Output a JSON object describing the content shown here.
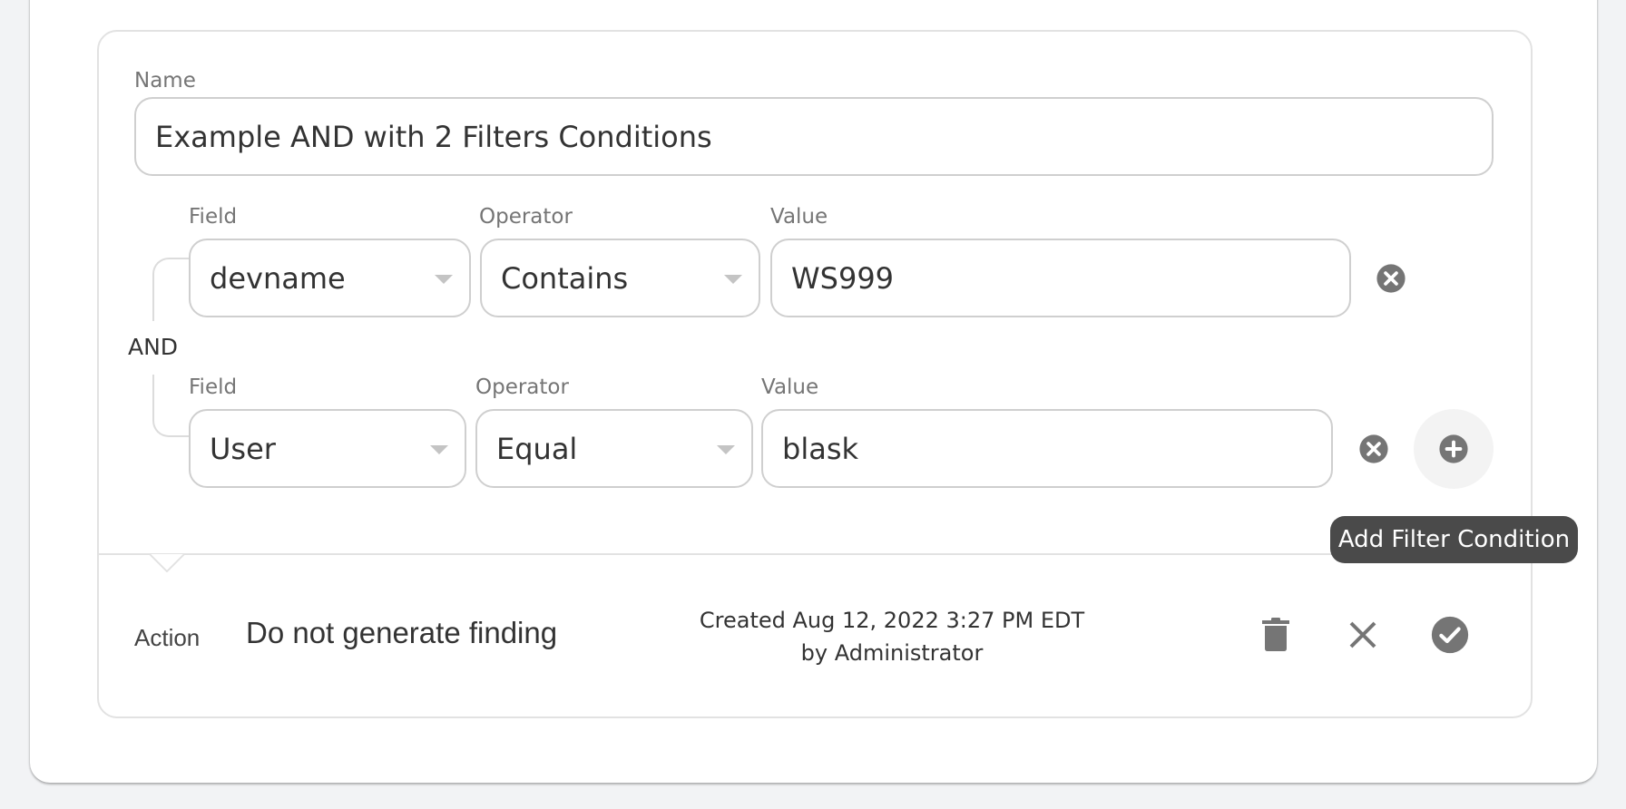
{
  "form": {
    "name_label": "Name",
    "name_value": "Example AND with 2 Filters Conditions",
    "logic_operator": "AND",
    "conditions": [
      {
        "field_label": "Field",
        "field_value": "devname",
        "operator_label": "Operator",
        "operator_value": "Contains",
        "value_label": "Value",
        "value": "WS999",
        "remove_icon": "remove-circle-icon"
      },
      {
        "field_label": "Field",
        "field_value": "User",
        "operator_label": "Operator",
        "operator_value": "Equal",
        "value_label": "Value",
        "value": "blask",
        "remove_icon": "remove-circle-icon"
      }
    ],
    "add_condition_icon": "plus-circle-icon",
    "add_condition_tooltip": "Add Filter Condition"
  },
  "footer": {
    "action_label": "Action",
    "action_value": "Do not generate finding",
    "created_line1": "Created Aug 12, 2022 3:27 PM EDT",
    "created_line2": "by Administrator",
    "icons": [
      "trash-icon",
      "close-icon",
      "check-circle-icon"
    ]
  },
  "colors": {
    "icon": "#757575",
    "tooltip_bg": "#4a4a4a",
    "border": "#cfcfcf",
    "page_bg": "#f2f3f5"
  }
}
